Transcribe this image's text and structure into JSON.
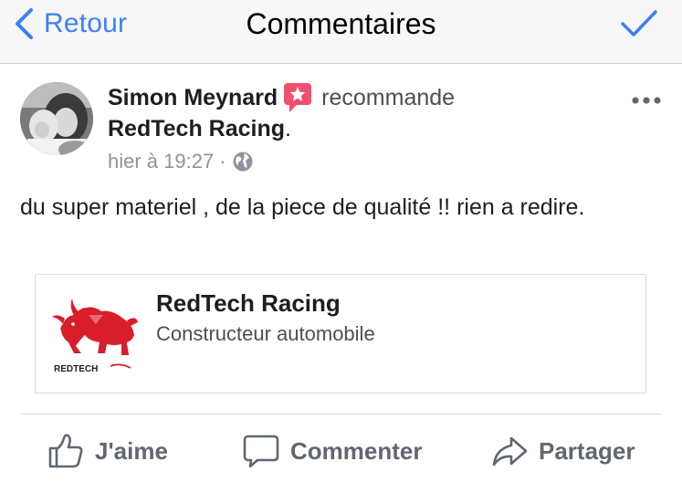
{
  "navbar": {
    "back_label": "Retour",
    "title": "Commentaires",
    "accent_color": "#3b7ff6"
  },
  "post": {
    "author": "Simon Meynard",
    "verb": "recommande",
    "page": "RedTech Racing",
    "page_suffix": ".",
    "timestamp": "hier à 19:27",
    "separator": "·",
    "audience_icon": "globe-icon",
    "text": "du super materiel , de la piece de qualité !! rien a redire.",
    "recommend_badge_color": "#f0506e"
  },
  "card": {
    "title": "RedTech Racing",
    "subtitle": "Constructeur automobile",
    "logo_text": "REDTECH"
  },
  "actions": {
    "like": "J'aime",
    "comment": "Commenter",
    "share": "Partager"
  }
}
